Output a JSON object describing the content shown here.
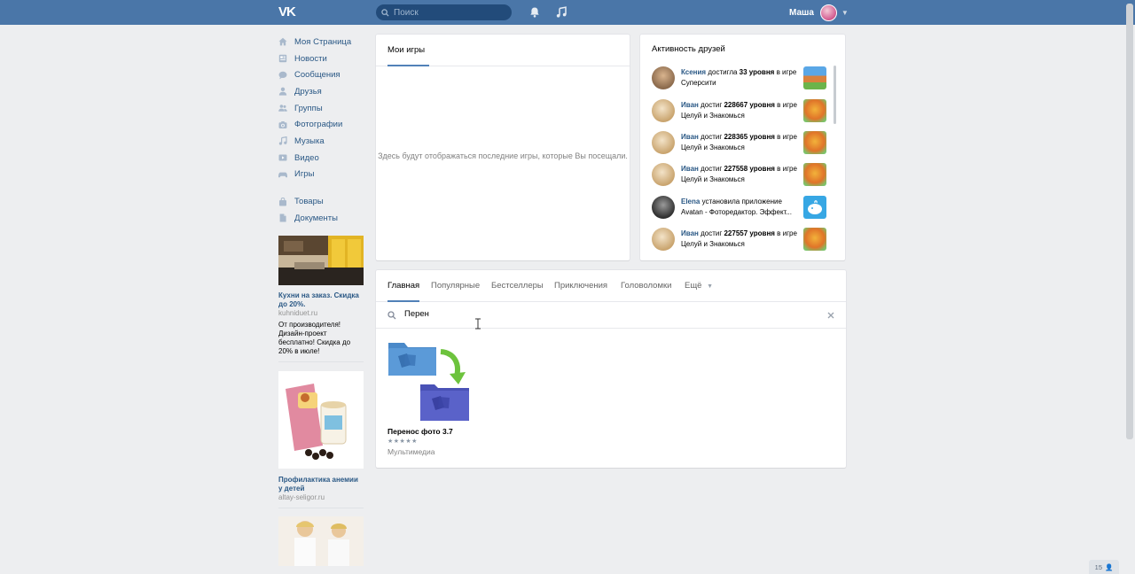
{
  "header": {
    "logo": "VK",
    "search_placeholder": "Поиск",
    "user_name": "Маша"
  },
  "nav": {
    "items": [
      {
        "label": "Моя Страница",
        "icon": "home-icon"
      },
      {
        "label": "Новости",
        "icon": "news-icon"
      },
      {
        "label": "Сообщения",
        "icon": "messages-icon"
      },
      {
        "label": "Друзья",
        "icon": "friends-icon"
      },
      {
        "label": "Группы",
        "icon": "groups-icon"
      },
      {
        "label": "Фотографии",
        "icon": "photos-icon"
      },
      {
        "label": "Музыка",
        "icon": "music-icon"
      },
      {
        "label": "Видео",
        "icon": "video-icon"
      },
      {
        "label": "Игры",
        "icon": "games-icon"
      }
    ],
    "extra": [
      {
        "label": "Товары",
        "icon": "goods-icon"
      },
      {
        "label": "Документы",
        "icon": "documents-icon"
      }
    ]
  },
  "ads": [
    {
      "title": "Кухни на заказ. Скидка до 20%.",
      "domain": "kuhniduet.ru",
      "body": "От производителя! Дизайн-проект бесплатно! Скидка до 20% в июле!"
    },
    {
      "title": "Профилактика анемии у детей",
      "domain": "altay-seligor.ru",
      "body": ""
    }
  ],
  "my_games": {
    "tab_label": "Мои игры",
    "empty_text": "Здесь будут отображаться последние игры, которые Вы посещали."
  },
  "activity": {
    "title": "Активность друзей",
    "items": [
      {
        "name": "Ксения",
        "verb": "достигла",
        "level": "33 уровня",
        "rest": "в игре Суперсити"
      },
      {
        "name": "Иван",
        "verb": "достиг",
        "level": "228667 уровня",
        "rest": "в игре Целуй и Знакомься"
      },
      {
        "name": "Иван",
        "verb": "достиг",
        "level": "228365 уровня",
        "rest": "в игре Целуй и Знакомься"
      },
      {
        "name": "Иван",
        "verb": "достиг",
        "level": "227558 уровня",
        "rest": "в игре Целуй и Знакомься"
      },
      {
        "name": "Elena",
        "verb": "установила приложение",
        "level": "",
        "rest": "Avatan - Фоторедактор. Эффект..."
      },
      {
        "name": "Иван",
        "verb": "достиг",
        "level": "227557 уровня",
        "rest": "в игре Целуй и Знакомься"
      }
    ]
  },
  "catalog": {
    "tabs": [
      "Главная",
      "Популярные",
      "Бестселлеры",
      "Приключения",
      "Головоломки",
      "Ещё"
    ],
    "search_value": "Перен",
    "result": {
      "title": "Перенос фото 3.7",
      "stars": "★★★★★",
      "category": "Мультимедиа"
    }
  },
  "counter": "15"
}
